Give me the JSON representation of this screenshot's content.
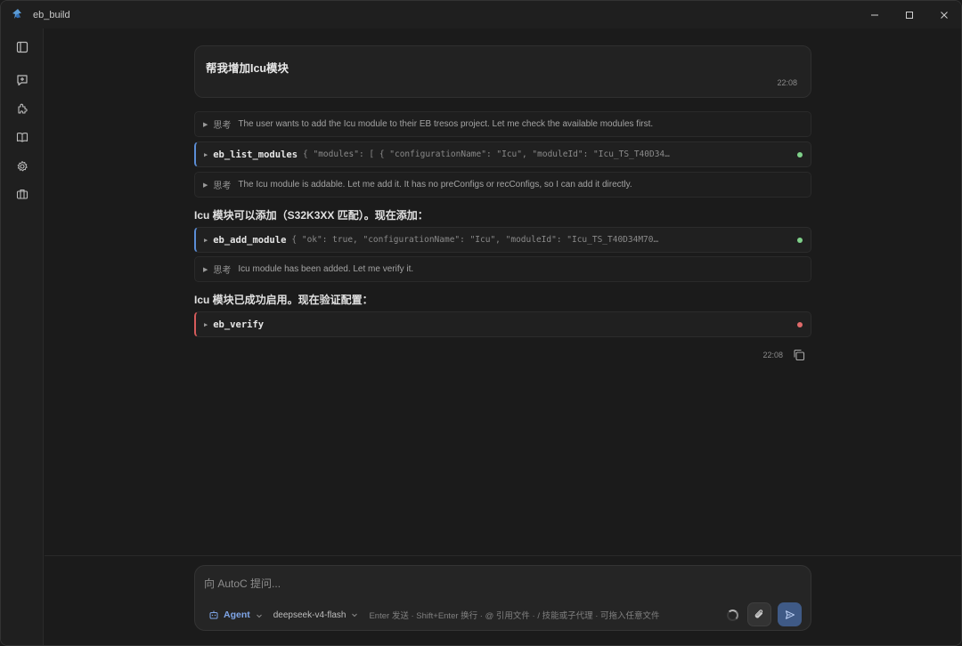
{
  "window": {
    "title": "eb_build",
    "logo_icon": "app-logo-icon",
    "controls": [
      "minimize-icon",
      "maximize-icon",
      "close-icon"
    ]
  },
  "sidebar": {
    "items": [
      {
        "name": "toggle-sidebar-icon"
      },
      {
        "name": "new-chat-icon"
      },
      {
        "name": "plugins-icon"
      },
      {
        "name": "book-icon"
      },
      {
        "name": "settings-icon"
      },
      {
        "name": "briefcase-icon"
      }
    ]
  },
  "conversation": {
    "user_message": {
      "text": "帮我增加Icu模块",
      "time": "22:08"
    },
    "think_label": "思考",
    "thinking": [
      "The user wants to add the Icu module to their EB tresos project. Let me check the available modules first.",
      "The Icu module is addable. Let me add it. It has no preConfigs or recConfigs, so I can add it directly.",
      "Icu module has been added. Let me verify it."
    ],
    "tools": [
      {
        "name": "eb_list_modules",
        "args": "{ \"modules\": [ { \"configurationName\": \"Icu\", \"moduleId\": \"Icu_TS_T40D34…",
        "status": "success",
        "status_color": "#7fd18a"
      },
      {
        "name": "eb_add_module",
        "args": "{ \"ok\": true, \"configurationName\": \"Icu\", \"moduleId\": \"Icu_TS_T40D34M70…",
        "status": "success",
        "status_color": "#7fd18a"
      },
      {
        "name": "eb_verify",
        "args": "",
        "status": "error",
        "status_color": "#e06a6a"
      }
    ],
    "assistant_texts": [
      "Icu 模块可以添加（S32K3XX 匹配）。现在添加：",
      "Icu 模块已成功启用。现在验证配置："
    ],
    "reply_time": "22:08",
    "copy_icon": "copy-icon"
  },
  "composer": {
    "placeholder": "向 AutoC 提问...",
    "mode_label": "Agent",
    "model_label": "deepseek-v4-flash",
    "hint": "Enter 发送 · Shift+Enter 换行 · @ 引用文件 · / 技能或子代理 · 可拖入任意文件",
    "accent_color": "#7fa6e8"
  }
}
